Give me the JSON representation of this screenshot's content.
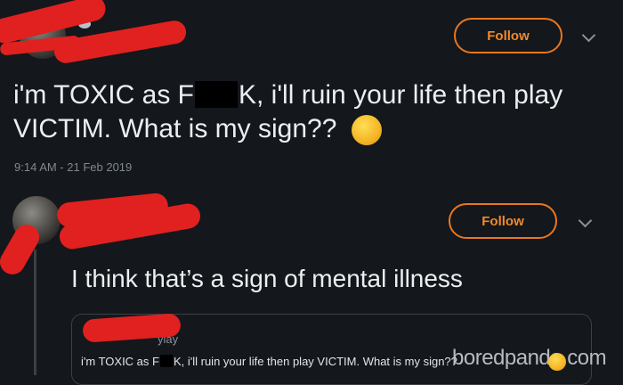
{
  "tweet1": {
    "follow_label": "Follow",
    "text_before": "i'm TOXIC as F",
    "text_after_censor": "K, i'll ruin your life then play",
    "text_line2": "VICTIM. What is my sign??",
    "emoji_icon": "thinking-face-icon",
    "timestamp": "9:14 AM - 21 Feb 2019"
  },
  "tweet2": {
    "follow_label": "Follow",
    "text": "I think that’s a sign of mental illness",
    "quoted": {
      "handle_fragment": "ylay",
      "text_before": "i'm TOXIC as F",
      "text_after_censor": "K, i'll ruin your life then play VICTIM. What is my sign??"
    }
  },
  "watermark": "boredpanda.com",
  "colors": {
    "background": "#14171c",
    "follow_accent": "#e8771f",
    "redaction": "#e0211f"
  }
}
